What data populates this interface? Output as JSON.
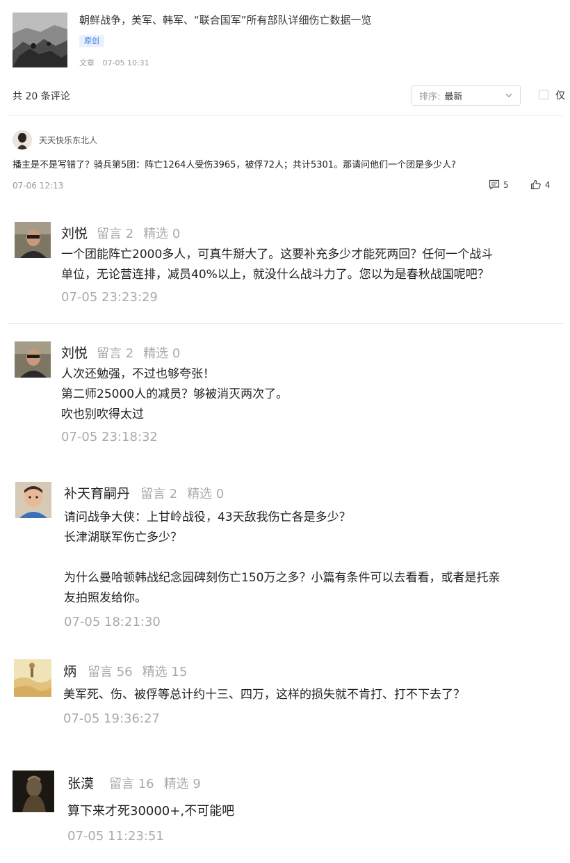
{
  "article": {
    "title": "朝鲜战争，美军、韩军、“联合国军”所有部队详细伤亡数据一览",
    "tag": "原创",
    "type": "文章",
    "time": "07-05 10:31"
  },
  "comments_header": {
    "count": "共 20 条评论",
    "sort_label": "排序:",
    "sort_value": "最新",
    "only_label": "仅"
  },
  "first_comment": {
    "user": "天天快乐东北人",
    "text": "播主是不是写错了？骑兵第5团：阵亡1264人受伤3965，被俘72人；共计5301。那请问他们一个团是多少人?",
    "time": "07-06 12:13",
    "replies": "5",
    "likes": "4"
  },
  "comments": [
    {
      "user": "刘悦",
      "liuyan": "留言 2",
      "jingxuan": "精选 0",
      "lines": [
        "一个团能阵亡2000多人，可真牛掰大了。这要补充多少才能死两回？任何一个战斗",
        "单位，无论营连排，减员40%以上，就没什么战斗力了。您以为是春秋战国呢吧？"
      ],
      "time": "07-05 23:23:29"
    },
    {
      "user": "刘悦",
      "liuyan": "留言 2",
      "jingxuan": "精选 0",
      "lines": [
        "人次还勉强，不过也够夸张！",
        "第二师25000人的减员？够被消灭两次了。",
        "吹也别吹得太过"
      ],
      "time": "07-05 23:18:32"
    },
    {
      "user": "补天育嗣丹",
      "liuyan": "留言 2",
      "jingxuan": "精选 0",
      "lines": [
        "请问战争大侠：上甘岭战役，43天敌我伤亡各是多少？",
        "长津湖联军伤亡多少？",
        "",
        "为什么曼哈顿韩战纪念园碑刻伤亡150万之多？小篇有条件可以去看看，或者是托亲",
        "友拍照发给你。"
      ],
      "time": "07-05 18:21:30"
    },
    {
      "user": "炳",
      "liuyan": "留言 56",
      "jingxuan": "精选 15",
      "lines": [
        "美军死、伤、被俘等总计约十三、四万，这样的损失就不肯打、打不下去了？"
      ],
      "time": "07-05 19:36:27"
    },
    {
      "user": "张漠",
      "liuyan": "留言 16",
      "jingxuan": "精选 9",
      "lines": [
        "算下来才死30000+,不可能吧"
      ],
      "time": "07-05 11:23:51"
    }
  ],
  "colors": {
    "accent": "#3b7dd8",
    "muted": "#aaaaaa",
    "text": "#222222"
  }
}
